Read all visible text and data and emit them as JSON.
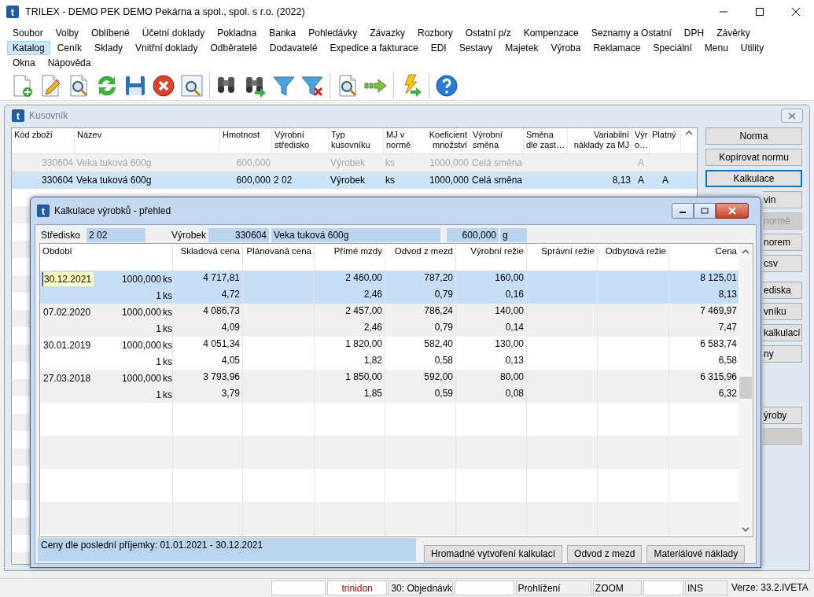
{
  "window": {
    "icon_letter": "t",
    "title": "TRILEX - DEMO PEK DEMO Pekárna a spol., spol. s r.o. (2022)"
  },
  "menu": {
    "rows": [
      {
        "items": [
          {
            "label": "Soubor",
            "selected": false
          },
          {
            "label": "Volby",
            "selected": false
          },
          {
            "label": "Oblíbené",
            "selected": false
          },
          {
            "label": "Účetní doklady",
            "selected": false
          },
          {
            "label": "Pokladna",
            "selected": false
          },
          {
            "label": "Banka",
            "selected": false
          },
          {
            "label": "Pohledávky",
            "selected": false
          },
          {
            "label": "Závazky",
            "selected": false
          },
          {
            "label": "Rozbory",
            "selected": false
          },
          {
            "label": "Ostatní p/z",
            "selected": false
          },
          {
            "label": "Kompenzace",
            "selected": false
          },
          {
            "label": "Seznamy a Ostatní",
            "selected": false
          },
          {
            "label": "DPH",
            "selected": false
          },
          {
            "label": "Závěrky",
            "selected": false
          }
        ]
      },
      {
        "items": [
          {
            "label": "Katalog",
            "selected": true
          },
          {
            "label": "Ceník",
            "selected": false
          },
          {
            "label": "Sklady",
            "selected": false
          },
          {
            "label": "Vnitřní doklady",
            "selected": false
          },
          {
            "label": "Odběratelé",
            "selected": false
          },
          {
            "label": "Dodavatelé",
            "selected": false
          },
          {
            "label": "Expedice a fakturace",
            "selected": false
          },
          {
            "label": "EDI",
            "selected": false
          },
          {
            "label": "Sestavy",
            "selected": false
          },
          {
            "label": "Majetek",
            "selected": false
          },
          {
            "label": "Výroba",
            "selected": false
          },
          {
            "label": "Reklamace",
            "selected": false
          },
          {
            "label": "Speciální",
            "selected": false
          },
          {
            "label": "Menu",
            "selected": false
          },
          {
            "label": "Utility",
            "selected": false
          }
        ]
      },
      {
        "items": [
          {
            "label": "Okna",
            "selected": false
          },
          {
            "label": "Nápověda",
            "selected": false
          }
        ]
      }
    ]
  },
  "kusovnik": {
    "icon_letter": "t",
    "title": "Kusovník",
    "columns": [
      "Kód zboží",
      "Název",
      "Hmotnost",
      "Výrobní\nstředisko",
      "Typ\nkusovníku",
      "MJ v\nnormě",
      "Koeficient\nmnožství",
      "Výrobní\nsměna",
      "Směna\ndle zast…",
      "Variabilní\nnáklady za MJ",
      "Výr\no…",
      "Platný"
    ],
    "rows": [
      {
        "selected": false,
        "disabled": true,
        "cells": [
          "330604",
          "Veka tuková 600g",
          "600,000",
          "",
          "Výrobek",
          "ks",
          "1000,000",
          "Celá směna",
          "",
          "",
          "A",
          ""
        ]
      },
      {
        "selected": true,
        "disabled": false,
        "cells": [
          "330604",
          "Veka tuková 600g",
          "600,000",
          "2 02",
          "Výrobek",
          "ks",
          "1000,000",
          "Celá směna",
          "",
          "8,13",
          "A",
          "A"
        ]
      }
    ],
    "button_groups": [
      [
        {
          "label": "Norma",
          "disabled": false,
          "kind": "full"
        },
        {
          "label": "Kopírovat normu",
          "disabled": false,
          "kind": "full"
        },
        {
          "label": "Kalkulace",
          "disabled": false,
          "kind": "full",
          "focused": true
        },
        {
          "label": "vin",
          "disabled": false,
          "kind": "partial"
        },
        {
          "label": "normě",
          "disabled": true,
          "kind": "partial"
        },
        {
          "label": "norem",
          "disabled": false,
          "kind": "partial"
        },
        {
          "label": "csv",
          "disabled": false,
          "kind": "partial"
        }
      ],
      [
        {
          "label": "ediska",
          "disabled": false,
          "kind": "partial"
        },
        {
          "label": "vníku",
          "disabled": false,
          "kind": "partial"
        },
        {
          "label": "kalkulací",
          "disabled": false,
          "kind": "partial"
        },
        {
          "label": "ny",
          "disabled": false,
          "kind": "partial"
        }
      ],
      [
        {
          "label": "ýroby",
          "disabled": false,
          "kind": "partial"
        },
        {
          "disabled": true,
          "kind": "partial"
        }
      ]
    ]
  },
  "dialog": {
    "icon_letter": "t",
    "title": "Kalkulace výrobků - přehled",
    "fields": {
      "stredisko_label": "Středisko",
      "stredisko": "2 02",
      "vyrobek_label": "Výrobek",
      "code": "330604",
      "name": "Veka tuková 600g",
      "weight": "600,000",
      "unit": "g"
    },
    "columns": [
      "Období",
      "Skladová cena",
      "Plánovaná cena",
      "Přímé mzdy",
      "Odvod z mezd",
      "Výrobní režie",
      "Správní režie",
      "Odbytová režie",
      "Cena"
    ],
    "rows": [
      {
        "selected": true,
        "date": "30.12.2021",
        "total": {
          "qty": "1000,000",
          "unit": "ks",
          "skladova_cena": "4 717,81",
          "prime_mzdy": "2 460,00",
          "odvod_z_mezd": "787,20",
          "vyrobni_rezie": "160,00",
          "cena": "8 125,01"
        },
        "per_unit": {
          "qty": "1",
          "unit": "ks",
          "skladova_cena": "4,72",
          "prime_mzdy": "2,46",
          "odvod_z_mezd": "0,79",
          "vyrobni_rezie": "0,16",
          "cena": "8,13"
        }
      },
      {
        "selected": false,
        "date": "07.02.2020",
        "total": {
          "qty": "1000,000",
          "unit": "ks",
          "skladova_cena": "4 086,73",
          "prime_mzdy": "2 457,00",
          "odvod_z_mezd": "786,24",
          "vyrobni_rezie": "140,00",
          "cena": "7 469,97"
        },
        "per_unit": {
          "qty": "1",
          "unit": "ks",
          "skladova_cena": "4,09",
          "prime_mzdy": "2,46",
          "odvod_z_mezd": "0,79",
          "vyrobni_rezie": "0,14",
          "cena": "7,47"
        }
      },
      {
        "selected": false,
        "date": "30.01.2019",
        "total": {
          "qty": "1000,000",
          "unit": "ks",
          "skladova_cena": "4 051,34",
          "prime_mzdy": "1 820,00",
          "odvod_z_mezd": "582,40",
          "vyrobni_rezie": "130,00",
          "cena": "6 583,74"
        },
        "per_unit": {
          "qty": "1",
          "unit": "ks",
          "skladova_cena": "4,05",
          "prime_mzdy": "1,82",
          "odvod_z_mezd": "0,58",
          "vyrobni_rezie": "0,13",
          "cena": "6,58"
        }
      },
      {
        "selected": false,
        "date": "27.03.2018",
        "total": {
          "qty": "1000,000",
          "unit": "ks",
          "skladova_cena": "3 793,96",
          "prime_mzdy": "1 850,00",
          "odvod_z_mezd": "592,00",
          "vyrobni_rezie": "80,00",
          "cena": "6 315,96"
        },
        "per_unit": {
          "qty": "1",
          "unit": "ks",
          "skladova_cena": "3,79",
          "prime_mzdy": "1,85",
          "odvod_z_mezd": "0,59",
          "vyrobni_rezie": "0,08",
          "cena": "6,32"
        }
      }
    ],
    "note": "Ceny dle poslední příjemky: 01.01.2021 - 30.12.2021",
    "buttons": [
      "Hromadné vytvoření kalkulací",
      "Odvod z mezd",
      "Materiálové náklady"
    ]
  },
  "status_bar": [
    {
      "kind": "blank"
    },
    {
      "kind": "text",
      "text": "trinidon",
      "highlight": true
    },
    {
      "kind": "text",
      "text": "30: Objednávk",
      "highlight": false
    },
    {
      "kind": "blank"
    },
    {
      "kind": "text",
      "text": "Prohlížení",
      "highlight": false
    },
    {
      "kind": "text",
      "text": "ZOOM",
      "highlight": false
    },
    {
      "kind": "blank"
    },
    {
      "kind": "text",
      "text": "INS",
      "highlight": false
    },
    {
      "kind": "text",
      "text": "Verze: 33.2.IVETA",
      "highlight": false
    }
  ]
}
